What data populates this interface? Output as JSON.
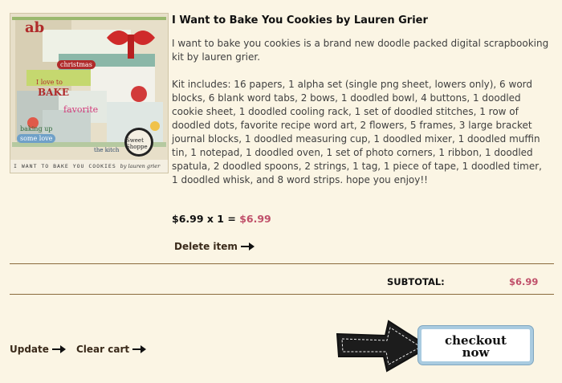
{
  "product": {
    "title": "I Want to Bake You Cookies by Lauren Grier",
    "intro": "I want to bake you cookies is a brand new doodle packed digital scrapbooking kit by lauren grier.",
    "kit_includes": "Kit includes: 16 papers, 1 alpha set (single png sheet, lowers only), 6 word blocks, 6 blank word tabs, 2 bows, 1 doodled bowl, 4 buttons, 1 doodled cookie sheet, 1 doodled cooling rack, 1 set of doodled stitches, 1 row of doodled dots, favorite recipe word art, 2 flowers, 5 frames, 3 large bracket journal blocks, 1 doodled measuring cup, 1 doodled mixer, 1 doodled muffin tin, 1 notepad, 1 doodled oven, 1 set of photo corners, 1 ribbon, 1 doodled spatula, 2 doodled spoons, 2 strings, 1 tag, 1 piece of tape, 1 doodled timer, 1 doodled whisk, and 8 word strips. hope you enjoy!!",
    "price_expression": "$6.99 x 1 = ",
    "price_total": "$6.99",
    "delete_label": "Delete item",
    "image": {
      "caption": "I WANT TO BAKE YOU COOKIES",
      "credit": "by lauren grier",
      "labels": [
        "ab",
        "christmas",
        "I love to",
        "BAKE",
        "favorite",
        "baking up",
        "some love",
        "Sweet Shoppe",
        "the kitch"
      ]
    }
  },
  "cart": {
    "subtotal_label": "SUBTOTAL:",
    "subtotal_value": "$6.99",
    "update_label": "Update",
    "clear_label": "Clear cart",
    "checkout_label_line1": "checkout",
    "checkout_label_line2": "now"
  },
  "colors": {
    "background": "#fbf5e4",
    "accent_price": "#c0506a",
    "divider": "#8a6a3c",
    "checkout_border": "#a9cbe0"
  }
}
